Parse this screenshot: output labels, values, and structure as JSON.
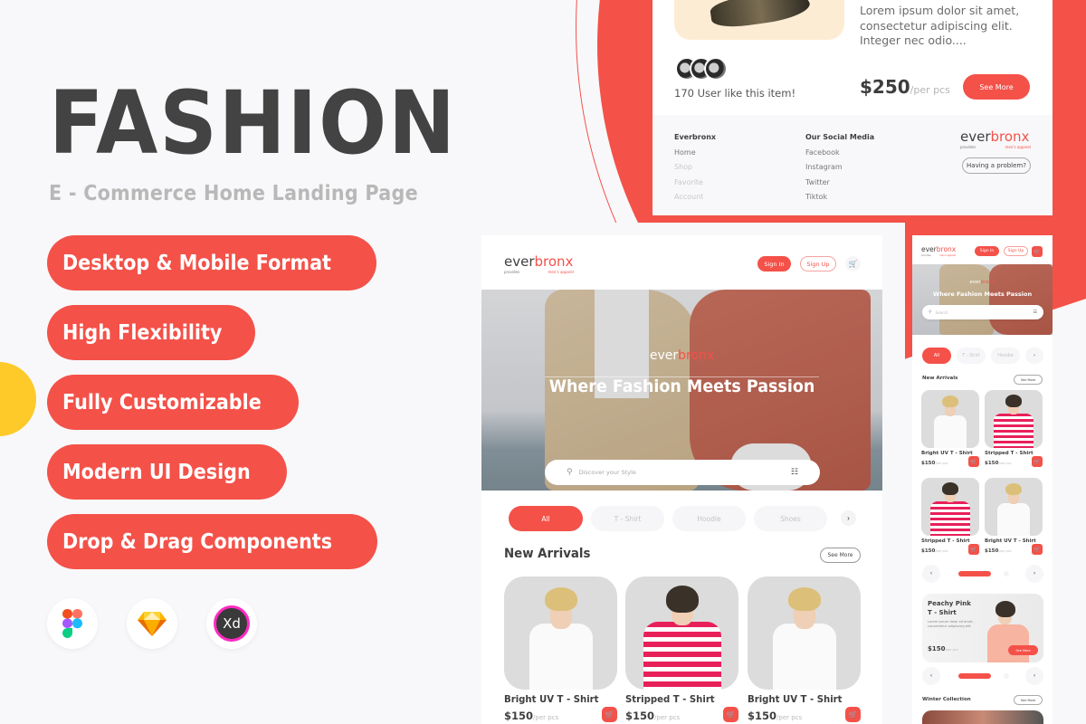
{
  "colors": {
    "accent": "#f45149",
    "yellow": "#fdca2a",
    "text_dark": "#434343",
    "text_muted": "#b8b8b8"
  },
  "hero": {
    "title": "FASHION",
    "subtitle": "E - Commerce Home Landing Page",
    "features": [
      "Desktop & Mobile Format",
      "High Flexibility",
      "Fully Customizable",
      "Modern UI Design",
      "Drop & Drag Components"
    ],
    "tools": [
      {
        "name": "figma-icon",
        "label": ""
      },
      {
        "name": "sketch-icon",
        "label": ""
      },
      {
        "name": "xd-icon",
        "label": "Xd"
      }
    ]
  },
  "brand": {
    "word1": "ever",
    "word2": "bronx",
    "tag_left": "provides",
    "tag_right": "men's apparel"
  },
  "detail_card": {
    "description": "Lorem ipsum dolor sit amet, consectetur adipiscing elit. Integer nec odio....",
    "likes_text": "170 User like this item!",
    "price": "$250",
    "price_unit": "/per pcs",
    "see_more": "See More",
    "footer": {
      "col1": {
        "heading": "Everbronx",
        "links": [
          "Home",
          "Shop",
          "Favorite",
          "Account"
        ]
      },
      "col2": {
        "heading": "Our Social Media",
        "links": [
          "Facebook",
          "Instagram",
          "Twitter",
          "Tiktok"
        ]
      },
      "problem_button": "Having a problem?"
    }
  },
  "desktop": {
    "sign_in": "Sign In",
    "sign_up": "Sign Up",
    "hero_tagline": "Where Fashion Meets Passion",
    "search_placeholder": "Discover your Style",
    "categories": [
      "All",
      "T - Shirt",
      "Hoodie",
      "Shoes"
    ],
    "new_arrivals_title": "New Arrivals",
    "see_more": "See More",
    "products": [
      {
        "name": "Bright UV T - Shirt",
        "price": "$150",
        "unit": "/per pcs",
        "style": "white"
      },
      {
        "name": "Stripped T - Shirt",
        "price": "$150",
        "unit": "/per pcs",
        "style": "stripe"
      },
      {
        "name": "Bright UV T - Shirt",
        "price": "$150",
        "unit": "/per pcs",
        "style": "white"
      }
    ]
  },
  "mobile": {
    "sign_in": "Sign In",
    "sign_up": "Sign Up",
    "hero_tagline": "Where Fashion Meets Passion",
    "search_placeholder": "Search",
    "categories": [
      "All",
      "T - Shirt",
      "Hoodie"
    ],
    "new_arrivals_title": "New Arrivals",
    "see_more": "See More",
    "products": [
      {
        "name": "Bright UV T - Shirt",
        "price": "$150",
        "unit": "/per pcs"
      },
      {
        "name": "Stripped T - Shirt",
        "price": "$150",
        "unit": "/per pcs"
      },
      {
        "name": "Stripped T - Shirt",
        "price": "$150",
        "unit": "/per pcs"
      },
      {
        "name": "Bright UV T - Shirt",
        "price": "$150",
        "unit": "/per pcs"
      }
    ],
    "promo": {
      "title_line1": "Peachy Pink",
      "title_line2": "T - Shirt",
      "description": "Lorem ipsum dolor sit amet, consectetur adipiscing elit.",
      "price": "$150",
      "unit": "/per pcs",
      "button": "See More"
    },
    "winter_title": "Winter Collection"
  }
}
